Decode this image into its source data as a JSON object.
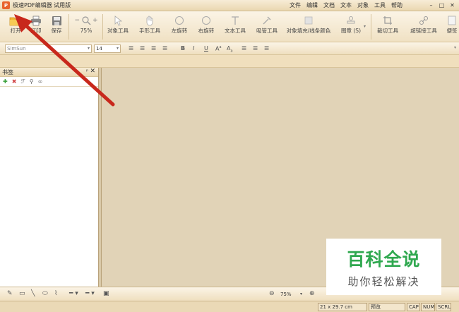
{
  "title_bar": {
    "app_icon_text": "P",
    "title": "极速PDF编辑器 试用版",
    "menu": [
      "文件",
      "编辑",
      "文档",
      "文本",
      "对象",
      "工具",
      "帮助"
    ],
    "window_controls": [
      "–",
      "□",
      "✕"
    ]
  },
  "toolbar": {
    "open": "打开",
    "print": "打印",
    "save": "保存",
    "zoom_value": "75%",
    "object_tool": "对象工具",
    "hand_tool": "手形工具",
    "rotate_left": "左旋转",
    "rotate_right": "右旋转",
    "text_tool": "文本工具",
    "eyedropper_tool": "吸管工具",
    "fill_line_color": "对象填充/线条颜色",
    "stamp": "图章 (S)",
    "crop_tool": "裁切工具",
    "link_tool": "超链接工具",
    "sticky": "便签"
  },
  "format_bar": {
    "font": "SimSun",
    "size": "14",
    "bold": "B",
    "italic": "I",
    "underline": "U",
    "superscript": "A",
    "subscript": "A"
  },
  "bookmark_panel": {
    "title": "书签",
    "pin": "ᵖ",
    "close": "✕"
  },
  "bottom_bar": {
    "zoom_value": "75%"
  },
  "status_bar": {
    "page_size": "21 x 29.7 cm",
    "mode": "预览",
    "cap": "CAP",
    "num": "NUM",
    "scrl": "SCRL"
  },
  "watermark": {
    "title": "百科全说",
    "subtitle": "助你轻松解决"
  },
  "colors": {
    "accent_arrow": "#c8281c",
    "watermark_green": "#2fa84f",
    "app_icon": "#e8632b"
  }
}
